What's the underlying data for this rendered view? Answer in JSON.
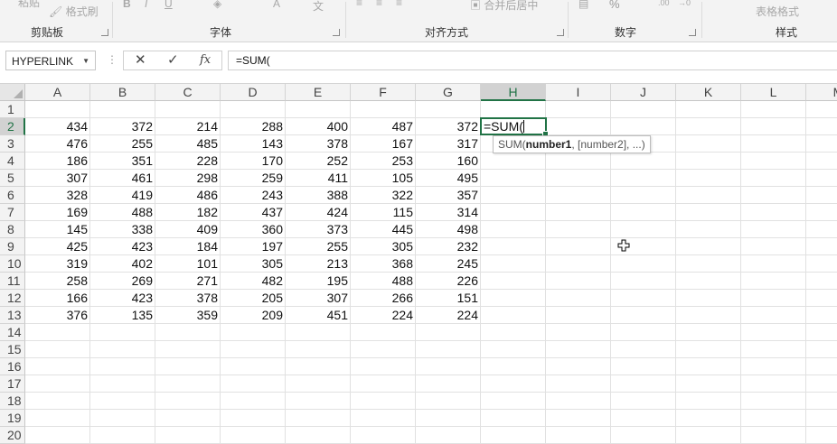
{
  "ribbon": {
    "clipboard": {
      "label": "剪贴板",
      "format_painter": "格式刷"
    },
    "font": {
      "label": "字体"
    },
    "alignment": {
      "label": "对齐方式",
      "merge_center": "合并后居中"
    },
    "number": {
      "label": "数字",
      "percent": "%"
    },
    "styles": {
      "label": "样式",
      "table_format": "表格格式"
    }
  },
  "formula_bar": {
    "name_box": "HYPERLINK",
    "cancel_icon": "✕",
    "enter_icon": "✓",
    "fx_label": "fx",
    "formula": "=SUM("
  },
  "sheet": {
    "columns": [
      "A",
      "B",
      "C",
      "D",
      "E",
      "F",
      "G",
      "H",
      "I",
      "J",
      "K",
      "L",
      "M"
    ],
    "rows": [
      "1",
      "2",
      "3",
      "4",
      "5",
      "6",
      "7",
      "8",
      "9",
      "10",
      "11",
      "12",
      "13",
      "14",
      "15",
      "16",
      "17",
      "18",
      "19",
      "20"
    ],
    "selected_column": "H",
    "selected_row": "2",
    "data": [
      [
        434,
        372,
        214,
        288,
        400,
        487,
        372
      ],
      [
        476,
        255,
        485,
        143,
        378,
        167,
        317
      ],
      [
        186,
        351,
        228,
        170,
        252,
        253,
        160
      ],
      [
        307,
        461,
        298,
        259,
        411,
        105,
        495
      ],
      [
        328,
        419,
        486,
        243,
        388,
        322,
        357
      ],
      [
        169,
        488,
        182,
        437,
        424,
        115,
        314
      ],
      [
        145,
        338,
        409,
        360,
        373,
        445,
        498
      ],
      [
        425,
        423,
        184,
        197,
        255,
        305,
        232
      ],
      [
        319,
        402,
        101,
        305,
        213,
        368,
        245
      ],
      [
        258,
        269,
        271,
        482,
        195,
        488,
        226
      ],
      [
        166,
        423,
        378,
        205,
        307,
        266,
        151
      ],
      [
        376,
        135,
        359,
        209,
        451,
        224,
        224
      ]
    ],
    "active_cell": {
      "ref": "H2",
      "value": "=SUM("
    },
    "tooltip": {
      "func": "SUM(",
      "arg1": "number1",
      "rest": ", [number2], ...)"
    }
  },
  "icons": {
    "cursor": "plus-cursor-icon"
  },
  "colors": {
    "accent": "#217346"
  }
}
